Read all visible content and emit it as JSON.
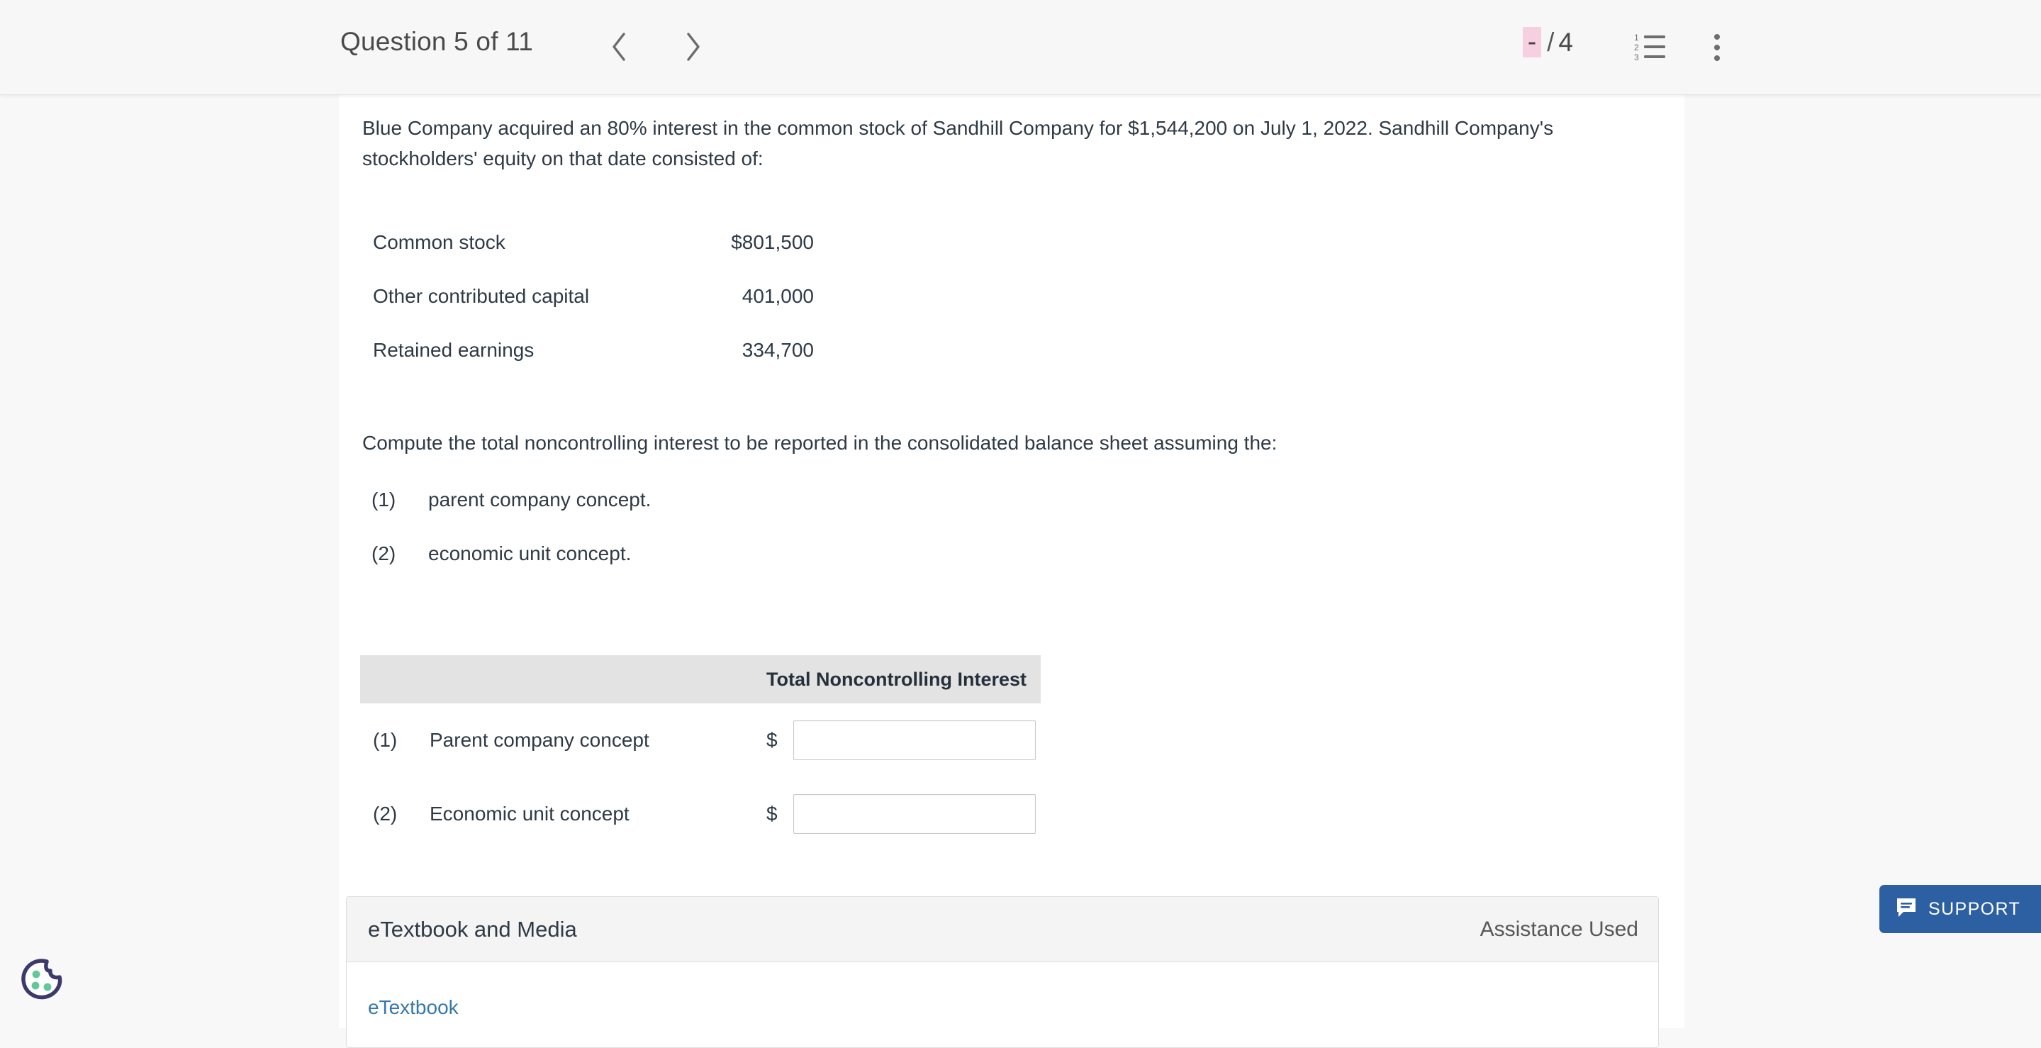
{
  "header": {
    "question_title": "Question 5 of 11",
    "prev_label": "Previous question",
    "next_label": "Next question",
    "score_value": "-",
    "score_separator": "/",
    "score_total": "4",
    "score_highlight_color": "#f6cfe0",
    "list_icon": "numbered-list-icon",
    "menu_icon": "more-vertical-icon"
  },
  "question": {
    "intro": "Blue Company acquired an 80% interest in the common stock of Sandhill Company for $1,544,200 on July 1, 2022. Sandhill Company's stockholders' equity on that date consisted of:",
    "equity_rows": [
      {
        "label": "Common stock",
        "value": "$801,500"
      },
      {
        "label": "Other contributed capital",
        "value": "401,000"
      },
      {
        "label": "Retained earnings",
        "value": "334,700"
      }
    ],
    "instruction": "Compute the total noncontrolling interest to be reported in the consolidated balance sheet assuming the:",
    "concepts": [
      {
        "num": "(1)",
        "text": "parent company concept."
      },
      {
        "num": "(2)",
        "text": "economic unit concept."
      }
    ]
  },
  "answer_table": {
    "column_header": "Total Noncontrolling Interest",
    "rows": [
      {
        "num": "(1)",
        "label": "Parent company concept",
        "currency": "$",
        "value": "",
        "placeholder": ""
      },
      {
        "num": "(2)",
        "label": "Economic unit concept",
        "currency": "$",
        "value": "",
        "placeholder": ""
      }
    ]
  },
  "etextbook": {
    "title": "eTextbook and Media",
    "assistance": "Assistance Used",
    "link": "eTextbook"
  },
  "support": {
    "label": "SUPPORT",
    "icon": "chat-bubble-icon",
    "color": "#2d5fa3"
  },
  "cookie": {
    "icon": "cookie-consent-icon",
    "outline_color": "#3b3a6b",
    "chip_color": "#62c79a"
  }
}
